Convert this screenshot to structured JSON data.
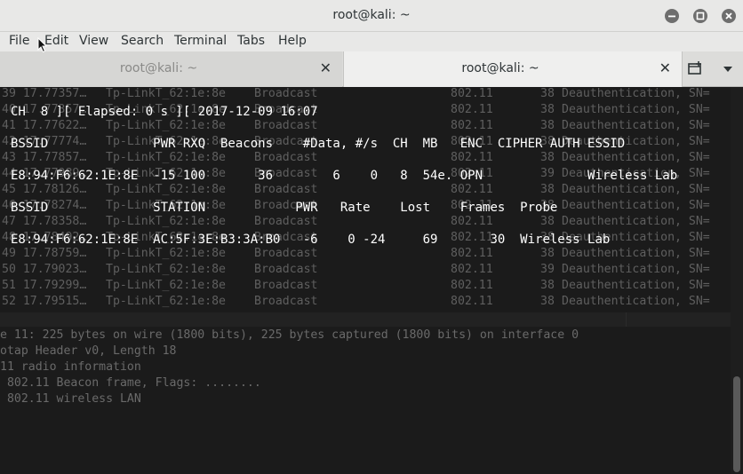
{
  "window": {
    "title": "root@kali: ~"
  },
  "menubar": {
    "items": [
      "File",
      "Edit",
      "View",
      "Search",
      "Terminal",
      "Tabs",
      "Help"
    ]
  },
  "tabs": [
    {
      "label": "root@kali: ~",
      "active": false
    },
    {
      "label": "root@kali: ~",
      "active": true
    }
  ],
  "wireshark_rows": [
    {
      "num": "39 17.77357…",
      "src": "Tp-LinkT_62:1e:8e",
      "dst": "Broadcast",
      "proto": "802.11",
      "len": "38",
      "info": "Deauthentication, SN="
    },
    {
      "num": "40 17.77357…",
      "src": "Tp-LinkT_62:1e:8e",
      "dst": "Broadcast",
      "proto": "802.11",
      "len": "38",
      "info": "Deauthentication, SN="
    },
    {
      "num": "41 17.77622…",
      "src": "Tp-LinkT_62:1e:8e",
      "dst": "Broadcast",
      "proto": "802.11",
      "len": "38",
      "info": "Deauthentication, SN="
    },
    {
      "num": "42 17.77774…",
      "src": "Tp-LinkT_62:1e:8e",
      "dst": "Broadcast",
      "proto": "802.11",
      "len": "38",
      "info": "Deauthentication, SN="
    },
    {
      "num": "43 17.77857…",
      "src": "Tp-LinkT_62:1e:8e",
      "dst": "Broadcast",
      "proto": "802.11",
      "len": "38",
      "info": "Deauthentication, SN="
    },
    {
      "num": "44 17.77989…",
      "src": "Tp-LinkT_62:1e:8e",
      "dst": "Broadcast",
      "proto": "802.11",
      "len": "39",
      "info": "Deauthentication, SN="
    },
    {
      "num": "45 17.78126…",
      "src": "Tp-LinkT_62:1e:8e",
      "dst": "Broadcast",
      "proto": "802.11",
      "len": "38",
      "info": "Deauthentication, SN="
    },
    {
      "num": "46 17.78274…",
      "src": "Tp-LinkT_62:1e:8e",
      "dst": "Broadcast",
      "proto": "802.11",
      "len": "38",
      "info": "Deauthentication, SN="
    },
    {
      "num": "47 17.78358…",
      "src": "Tp-LinkT_62:1e:8e",
      "dst": "Broadcast",
      "proto": "802.11",
      "len": "38",
      "info": "Deauthentication, SN="
    },
    {
      "num": "48 17.78492…",
      "src": "Tp-LinkT_62:1e:8e",
      "dst": "Broadcast",
      "proto": "802.11",
      "len": "38",
      "info": "Deauthentication, SN="
    },
    {
      "num": "49 17.78759…",
      "src": "Tp-LinkT_62:1e:8e",
      "dst": "Broadcast",
      "proto": "802.11",
      "len": "38",
      "info": "Deauthentication, SN="
    },
    {
      "num": "50 17.79023…",
      "src": "Tp-LinkT_62:1e:8e",
      "dst": "Broadcast",
      "proto": "802.11",
      "len": "39",
      "info": "Deauthentication, SN="
    },
    {
      "num": "51 17.79299…",
      "src": "Tp-LinkT_62:1e:8e",
      "dst": "Broadcast",
      "proto": "802.11",
      "len": "38",
      "info": "Deauthentication, SN="
    },
    {
      "num": "52 17.79515…",
      "src": "Tp-LinkT_62:1e:8e",
      "dst": "Broadcast",
      "proto": "802.11",
      "len": "38",
      "info": "Deauthentication, SN="
    }
  ],
  "wireshark_detail": [
    "e 11: 225 bytes on wire (1800 bits), 225 bytes captured (1800 bits) on interface 0",
    "otap Header v0, Length 18",
    "11 radio information",
    " 802.11 Beacon frame, Flags: ........",
    " 802.11 wireless LAN"
  ],
  "airodump": {
    "status": "CH  8 ][ Elapsed: 0 s ][ 2017-12-09 16:07",
    "ap_header": "BSSID              PWR RXQ  Beacons    #Data, #/s  CH  MB   ENC  CIPHER AUTH ESSID",
    "ap_row": "E8:94:F6:62:1E:8E  -15 100       36        6    0   8  54e. OPN              Wireless Lab",
    "sta_header": "BSSID              STATION            PWR   Rate    Lost    Frames  Probe",
    "sta_row": "E8:94:F6:62:1E:8E  AC:5F:3E:B3:3A:B0   -6    0 -24     69       30  Wireless Lab"
  }
}
